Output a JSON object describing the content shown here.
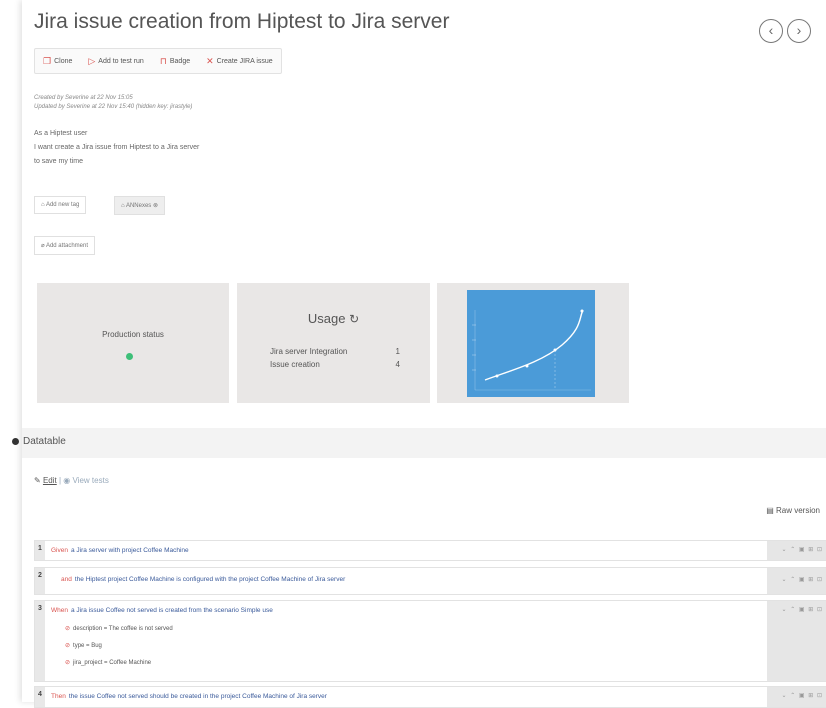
{
  "header": {
    "title": "Jira issue creation from Hiptest to Jira server",
    "prev_icon": "chevron-left-icon",
    "next_icon": "chevron-right-icon"
  },
  "toolbar": {
    "clone": "Clone",
    "add_to_test_run": "Add to test run",
    "badge": "Badge",
    "create_jira": "Create JIRA issue"
  },
  "meta": {
    "created": "Created by Severine at 22 Nov 15:05",
    "updated": "Updated by Severine at 22 Nov 15:40 (hidden key: jirastyle)"
  },
  "description": {
    "line1": "As a Hiptest user",
    "line2": "I want create a Jira issue from Hiptest to a Jira server",
    "line3": "to save my time"
  },
  "tags": {
    "add_tag": "Add new tag",
    "tag1": "ANNexes ⊗"
  },
  "attachment": {
    "label": "Add attachment"
  },
  "cards": {
    "production_label": "Production status",
    "usage_title": "Usage",
    "usage_rows": [
      {
        "label": "Jira server Integration",
        "value": "1"
      },
      {
        "label": "Issue creation",
        "value": "4"
      }
    ],
    "chart_color": "#4b9bd8"
  },
  "datatable": {
    "title": "Datatable",
    "edit": "Edit",
    "view_tests": "View tests",
    "raw_version": "Raw version"
  },
  "steps": [
    {
      "num": "1",
      "kw": "Given",
      "text": "a Jira server  with project Coffee Machine"
    },
    {
      "num": "2",
      "kw": "and",
      "text": "the Hiptest project Coffee Machine  is configured with the project Coffee Machine  of Jira server"
    },
    {
      "num": "3",
      "kw": "When",
      "text": "a Jira issue Coffee not served  is created from the scenario Simple use",
      "params": [
        "description = The coffee is not served",
        "type = Bug",
        "jira_project = Coffee Machine"
      ]
    },
    {
      "num": "4",
      "kw": "Then",
      "text": "the issue Coffee not served  should be created in the project Coffee Machine  of Jira server"
    }
  ]
}
